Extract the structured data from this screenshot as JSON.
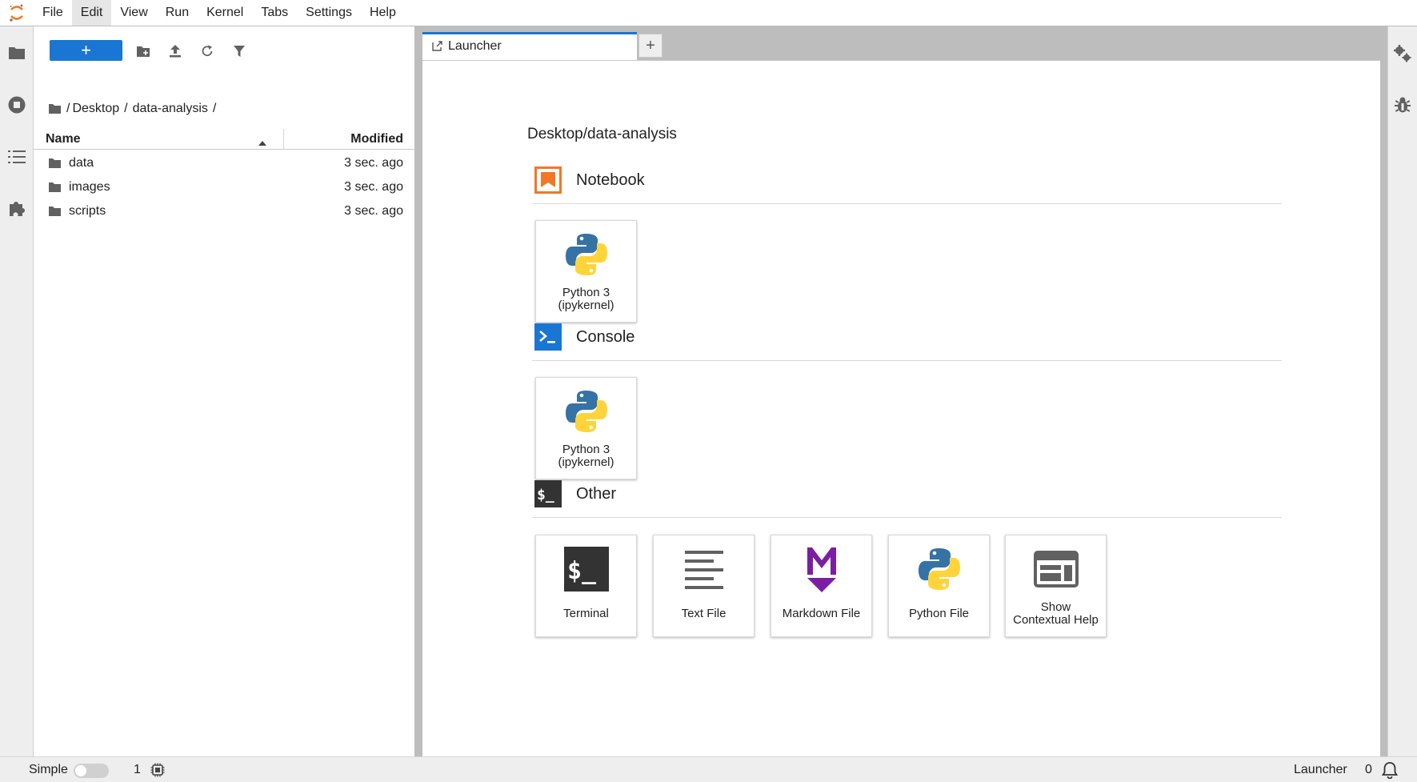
{
  "menubar": {
    "items": [
      "File",
      "Edit",
      "View",
      "Run",
      "Kernel",
      "Tabs",
      "Settings",
      "Help"
    ],
    "active_item": "Edit"
  },
  "left_sidebar": {
    "icons": [
      "folder-icon",
      "running-kernels-icon",
      "table-of-contents-icon",
      "extension-icon"
    ]
  },
  "file_browser": {
    "toolbar": {
      "new_launcher_label": "+",
      "icons": [
        "new-folder-icon",
        "upload-icon",
        "refresh-icon",
        "filter-icon"
      ]
    },
    "breadcrumb": {
      "root": "/",
      "parts": [
        "Desktop",
        "data-analysis"
      ],
      "separator": "/"
    },
    "columns": {
      "name": "Name",
      "modified": "Modified"
    },
    "sort": {
      "column": "name",
      "direction": "ascending"
    },
    "files": [
      {
        "name": "data",
        "type": "folder",
        "modified": "3 sec. ago"
      },
      {
        "name": "images",
        "type": "folder",
        "modified": "3 sec. ago"
      },
      {
        "name": "scripts",
        "type": "folder",
        "modified": "3 sec. ago"
      }
    ]
  },
  "tabs": {
    "active": {
      "label": "Launcher",
      "icon": "launcher-icon"
    },
    "new_tab_label": "+"
  },
  "launcher": {
    "cwd": "Desktop/data-analysis",
    "sections": {
      "notebook": {
        "title": "Notebook",
        "icon": "notebook-icon",
        "items": [
          {
            "line1": "Python 3",
            "line2": "(ipykernel)",
            "icon": "python-icon"
          }
        ]
      },
      "console": {
        "title": "Console",
        "icon": "console-icon",
        "items": [
          {
            "line1": "Python 3",
            "line2": "(ipykernel)",
            "icon": "python-icon"
          }
        ]
      },
      "other": {
        "title": "Other",
        "icon": "other-terminal-icon",
        "items": [
          {
            "line1": "Terminal",
            "icon": "terminal-icon"
          },
          {
            "line1": "Text File",
            "icon": "text-file-icon"
          },
          {
            "line1": "Markdown File",
            "icon": "markdown-icon"
          },
          {
            "line1": "Python File",
            "icon": "python-icon"
          },
          {
            "line1": "Show",
            "line2": "Contextual Help",
            "icon": "contextual-help-icon"
          }
        ]
      }
    }
  },
  "right_sidebar": {
    "icons": [
      "property-inspector-icon",
      "debugger-icon"
    ]
  },
  "statusbar": {
    "mode_label": "Simple",
    "simple_mode_enabled": false,
    "kernel_count": "1",
    "current_activity": "Launcher",
    "notification_count": "0"
  },
  "colors": {
    "accent": "#1976d2",
    "notebook_orange": "#f37726",
    "markdown_purple": "#7b1fa2",
    "python_blue": "#3572a5",
    "python_yellow": "#ffd43b",
    "chrome_gray": "#eeeeee",
    "dock_gray": "#bdbdbd"
  }
}
